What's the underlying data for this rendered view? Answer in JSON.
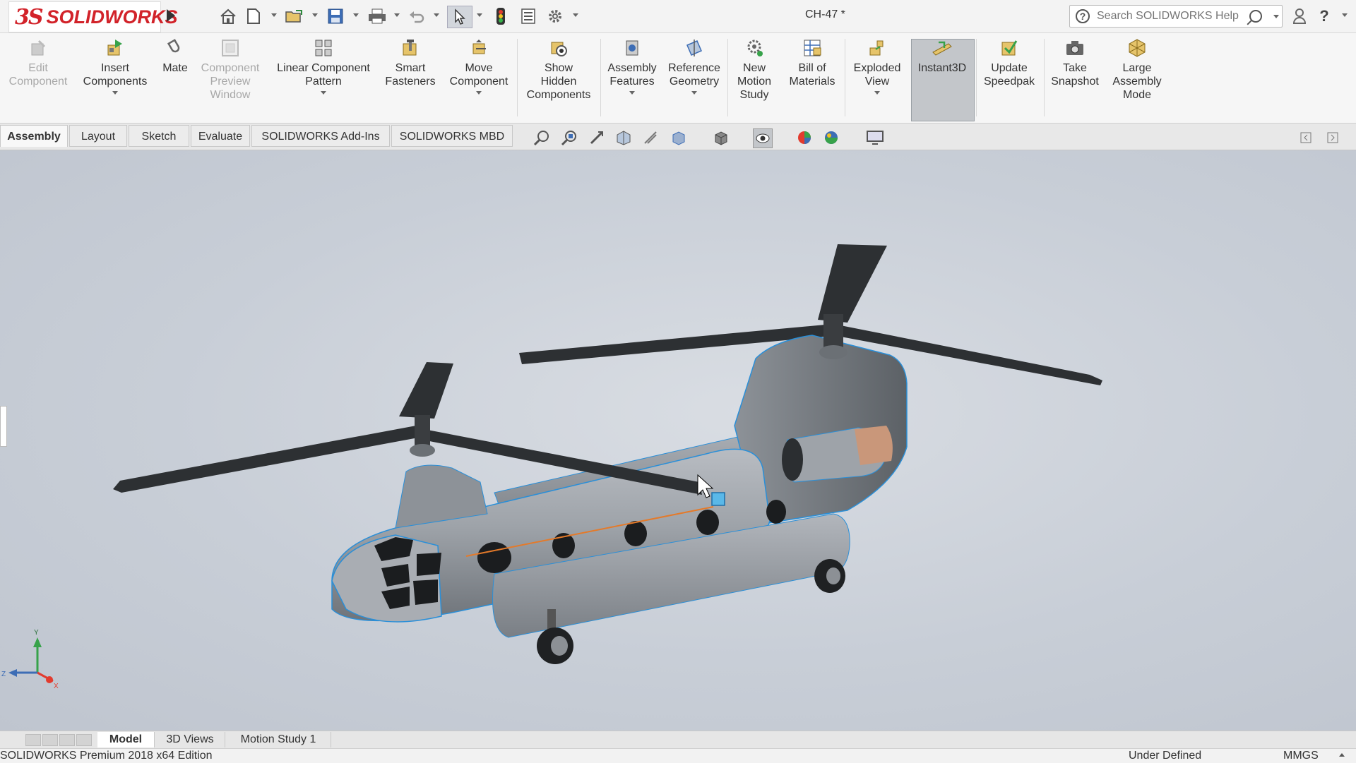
{
  "app": {
    "logo_ds": "3S",
    "logo_text": "SOLIDWORKS",
    "document_title": "CH-47 *"
  },
  "quick_access": [
    "home-icon",
    "new-document-icon",
    "open-icon",
    "save-icon",
    "print-icon",
    "undo-icon",
    "select-icon",
    "rebuild-icon",
    "file-properties-icon",
    "options-icon"
  ],
  "search": {
    "placeholder": "Search SOLIDWORKS Help"
  },
  "ribbon": {
    "buttons": [
      {
        "id": "edit-component",
        "label": "Edit\nComponent",
        "icon": "edit-component-icon",
        "enabled": false
      },
      {
        "id": "insert-components",
        "label": "Insert\nComponents",
        "icon": "insert-components-icon",
        "enabled": true
      },
      {
        "id": "mate",
        "label": "Mate",
        "icon": "mate-icon",
        "enabled": true
      },
      {
        "id": "component-preview-window",
        "label": "Component\nPreview\nWindow",
        "icon": "preview-window-icon",
        "enabled": false
      },
      {
        "id": "linear-component-pattern",
        "label": "Linear Component\nPattern",
        "icon": "linear-pattern-icon",
        "enabled": true
      },
      {
        "id": "smart-fasteners",
        "label": "Smart\nFasteners",
        "icon": "smart-fasteners-icon",
        "enabled": true
      },
      {
        "id": "move-component",
        "label": "Move\nComponent",
        "icon": "move-component-icon",
        "enabled": true
      },
      {
        "id": "show-hidden-components",
        "label": "Show\nHidden\nComponents",
        "icon": "show-hidden-icon",
        "enabled": true
      },
      {
        "id": "assembly-features",
        "label": "Assembly\nFeatures",
        "icon": "assembly-features-icon",
        "enabled": true
      },
      {
        "id": "reference-geometry",
        "label": "Reference\nGeometry",
        "icon": "reference-geometry-icon",
        "enabled": true
      },
      {
        "id": "new-motion-study",
        "label": "New\nMotion\nStudy",
        "icon": "motion-study-icon",
        "enabled": true
      },
      {
        "id": "bill-of-materials",
        "label": "Bill of\nMaterials",
        "icon": "bom-icon",
        "enabled": true
      },
      {
        "id": "exploded-view",
        "label": "Exploded\nView",
        "icon": "exploded-view-icon",
        "enabled": true
      },
      {
        "id": "instant3d",
        "label": "Instant3D",
        "icon": "instant3d-icon",
        "enabled": true,
        "active": true
      },
      {
        "id": "update-speedpak",
        "label": "Update\nSpeedpak",
        "icon": "speedpak-icon",
        "enabled": true
      },
      {
        "id": "take-snapshot",
        "label": "Take\nSnapshot",
        "icon": "camera-icon",
        "enabled": true
      },
      {
        "id": "large-assembly-mode",
        "label": "Large\nAssembly\nMode",
        "icon": "large-assembly-icon",
        "enabled": true
      }
    ]
  },
  "command_tabs": [
    "Assembly",
    "Layout",
    "Sketch",
    "Evaluate",
    "SOLIDWORKS Add-Ins",
    "SOLIDWORKS MBD"
  ],
  "active_command_tab": "Assembly",
  "heads_up_view": [
    "zoom-to-fit-icon",
    "zoom-to-area-icon",
    "previous-view-icon",
    "section-view-icon",
    "dynamic-annotation-icon",
    "view-orientation-icon",
    "display-style-icon",
    "hide-show-items-icon",
    "edit-appearance-icon",
    "apply-scene-icon",
    "view-settings-icon"
  ],
  "bottom_tabs": [
    "Model",
    "3D Views",
    "Motion Study 1"
  ],
  "active_bottom_tab": "Model",
  "status": {
    "edition": "SOLIDWORKS Premium 2018 x64 Edition",
    "state": "Under Defined",
    "units": "MMGS"
  },
  "triad": {
    "x_label": "X",
    "y_label": "Y",
    "z_label": "Z"
  },
  "colors": {
    "accent": "#d2232a",
    "selection_edge": "#2a8fd8",
    "instant3d_bg": "#c3c6ca"
  }
}
